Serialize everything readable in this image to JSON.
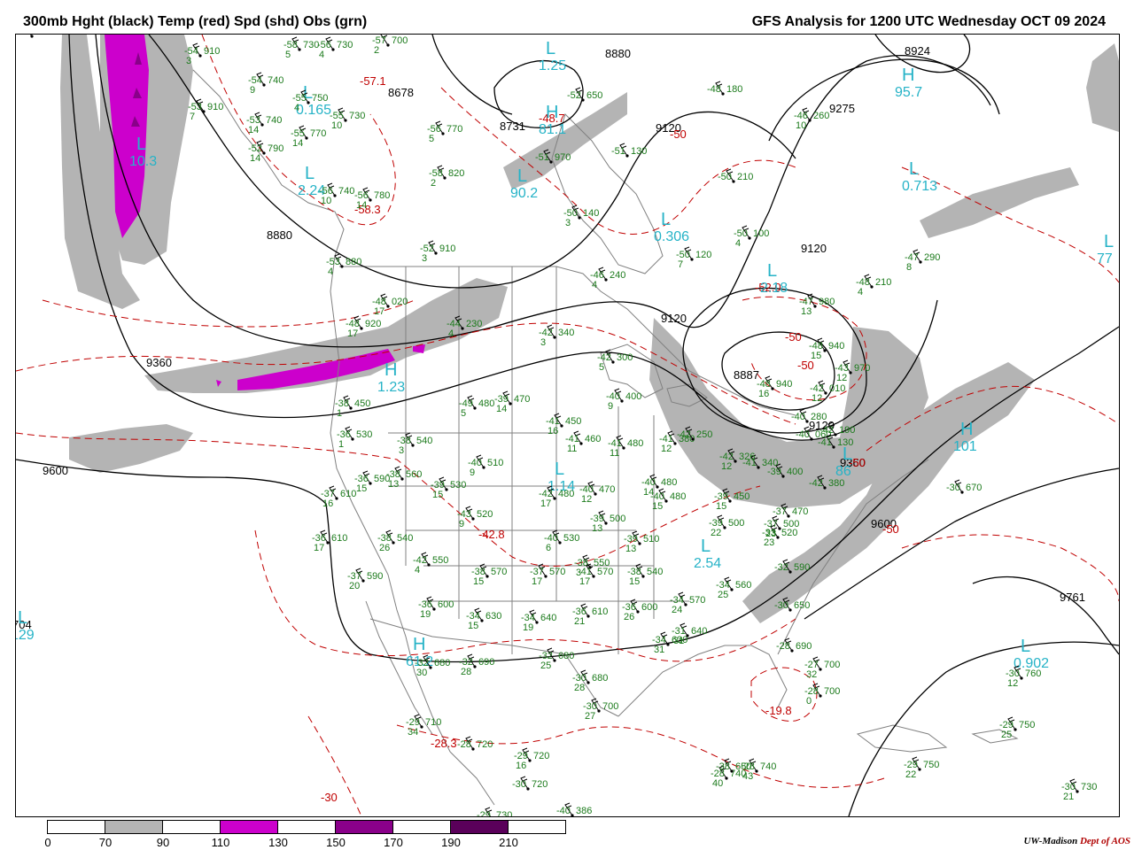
{
  "header": {
    "left_title": "300mb Hght (black) Temp (red) Spd (shd) Obs (grn)",
    "right_title": "GFS Analysis for 1200 UTC Wednesday  OCT 09 2024"
  },
  "legend": {
    "ticks": [
      "0",
      "70",
      "90",
      "110",
      "130",
      "150",
      "170",
      "190",
      "210"
    ],
    "colors": [
      "#ffffff",
      "#b4b4b4",
      "#ffffff",
      "#cc00cc",
      "#ffffff",
      "#8a008a",
      "#ffffff",
      "#5a005a",
      "#ffffff"
    ]
  },
  "credit": {
    "org": "UW-Madison",
    "dept": "Dept of AOS"
  },
  "colors": {
    "height": "#000000",
    "temp": "#c00000",
    "obs": "#1b7a1b",
    "shade_70": "#b4b4b4",
    "shade_110": "#cc00cc",
    "hl": "#26b3c7",
    "borders": "#808080"
  },
  "height_labels": [
    "8880",
    "8678",
    "8731",
    "8880",
    "9120",
    "9275",
    "8924",
    "9120",
    "9120",
    "9360",
    "8887",
    "9120",
    "9360",
    "9600",
    "9600",
    "9761",
    "704"
  ],
  "temp_labels": [
    "-57.1",
    "-48.7",
    "-50",
    "-58.3",
    "-52.0",
    "-50",
    "-50",
    "-42.8",
    "-50",
    "-50",
    "-19.8",
    "-28.3",
    "-30"
  ],
  "hl_markers": [
    {
      "letter": "L",
      "value": "1.25"
    },
    {
      "letter": "L",
      "value": "0.165"
    },
    {
      "letter": "L",
      "value": "2.24"
    },
    {
      "letter": "L",
      "value": "10.3"
    },
    {
      "letter": "H",
      "value": "81.1"
    },
    {
      "letter": "L",
      "value": "90.2"
    },
    {
      "letter": "L",
      "value": "0.306"
    },
    {
      "letter": "H",
      "value": "95.7"
    },
    {
      "letter": "L",
      "value": "0.713"
    },
    {
      "letter": "L",
      "value": "2.18"
    },
    {
      "letter": "H",
      "value": "1.23"
    },
    {
      "letter": "L",
      "value": "1.14"
    },
    {
      "letter": "L",
      "value": "2.54"
    },
    {
      "letter": "H",
      "value": "101"
    },
    {
      "letter": "L",
      "value": "86"
    },
    {
      "letter": "L",
      "value": "129"
    },
    {
      "letter": "H",
      "value": "61.2"
    },
    {
      "letter": "L",
      "value": "0.902"
    },
    {
      "letter": "L",
      "value": "77"
    }
  ],
  "observations": [
    {
      "t": "-54",
      "h": "910",
      "d": "3"
    },
    {
      "t": "-58",
      "h": "730",
      "d": "5"
    },
    {
      "t": "-56",
      "h": "730",
      "d": "4"
    },
    {
      "t": "-57",
      "h": "700",
      "d": "2"
    },
    {
      "t": "-54",
      "h": "740",
      "d": "9"
    },
    {
      "t": "-53",
      "h": "910",
      "d": "7"
    },
    {
      "t": "-55",
      "h": "750",
      "d": "4"
    },
    {
      "t": "-55",
      "h": "730",
      "d": "10"
    },
    {
      "t": "-53",
      "h": "740",
      "d": "14"
    },
    {
      "t": "-55",
      "h": "770",
      "d": "14"
    },
    {
      "t": "-52",
      "h": "790",
      "d": "14"
    },
    {
      "t": "-56",
      "h": "770",
      "d": "5"
    },
    {
      "t": "-52",
      "h": "650",
      "d": ""
    },
    {
      "t": "-51",
      "h": "970",
      "d": ""
    },
    {
      "t": "-51",
      "h": "130",
      "d": ""
    },
    {
      "t": "-48",
      "h": "180",
      "d": ""
    },
    {
      "t": "-46",
      "h": "260",
      "d": "10"
    },
    {
      "t": "-58",
      "h": "820",
      "d": "2"
    },
    {
      "t": "-56",
      "h": "740",
      "d": "10"
    },
    {
      "t": "-56",
      "h": "780",
      "d": "14"
    },
    {
      "t": "-50",
      "h": "140",
      "d": "3"
    },
    {
      "t": "-50",
      "h": "210",
      "d": ""
    },
    {
      "t": "-50",
      "h": "100",
      "d": "4"
    },
    {
      "t": "-50",
      "h": "120",
      "d": "7"
    },
    {
      "t": "-53",
      "h": "880",
      "d": "4"
    },
    {
      "t": "-52",
      "h": "910",
      "d": "3"
    },
    {
      "t": "-47",
      "h": "290",
      "d": "8"
    },
    {
      "t": "-48",
      "h": "210",
      "d": "4"
    },
    {
      "t": "-46",
      "h": "240",
      "d": "4"
    },
    {
      "t": "-48",
      "h": "020",
      "d": "17"
    },
    {
      "t": "-47",
      "h": "980",
      "d": "13"
    },
    {
      "t": "-48",
      "h": "920",
      "d": "17"
    },
    {
      "t": "-44",
      "h": "230",
      "d": "4"
    },
    {
      "t": "-42",
      "h": "340",
      "d": "3"
    },
    {
      "t": "-42",
      "h": "300",
      "d": "5"
    },
    {
      "t": "-48",
      "h": "940",
      "d": "15"
    },
    {
      "t": "-43",
      "h": "970",
      "d": "12"
    },
    {
      "t": "-42",
      "h": "010",
      "d": "12"
    },
    {
      "t": "-48",
      "h": "940",
      "d": "16"
    },
    {
      "t": "-40",
      "h": "400",
      "d": "9"
    },
    {
      "t": "-38",
      "h": "450",
      "d": "1"
    },
    {
      "t": "-49",
      "h": "480",
      "d": "5"
    },
    {
      "t": "-39",
      "h": "470",
      "d": "14"
    },
    {
      "t": "-41",
      "h": "450",
      "d": "16"
    },
    {
      "t": "-41",
      "h": "460",
      "d": "11"
    },
    {
      "t": "-41",
      "h": "480",
      "d": "11"
    },
    {
      "t": "-41",
      "h": "380",
      "d": "12"
    },
    {
      "t": "-36",
      "h": "530",
      "d": "1"
    },
    {
      "t": "-38",
      "h": "540",
      "d": "3"
    },
    {
      "t": "-40",
      "h": "510",
      "d": "9"
    },
    {
      "t": "-36",
      "h": "590",
      "d": "15"
    },
    {
      "t": "-38",
      "h": "560",
      "d": "13"
    },
    {
      "t": "-39",
      "h": "530",
      "d": "15"
    },
    {
      "t": "-42",
      "h": "480",
      "d": "17"
    },
    {
      "t": "-40",
      "h": "470",
      "d": "12"
    },
    {
      "t": "-40",
      "h": "480",
      "d": "14"
    },
    {
      "t": "-40",
      "h": "480",
      "d": "15"
    },
    {
      "t": "-37",
      "h": "610",
      "d": "16"
    },
    {
      "t": "-36",
      "h": "610",
      "d": "17"
    },
    {
      "t": "-38",
      "h": "540",
      "d": "26"
    },
    {
      "t": "-43",
      "h": "520",
      "d": "9"
    },
    {
      "t": "-40",
      "h": "530",
      "d": "6"
    },
    {
      "t": "-39",
      "h": "500",
      "d": "13"
    },
    {
      "t": "-39",
      "h": "510",
      "d": "13"
    },
    {
      "t": "-42",
      "h": "550",
      "d": "4"
    },
    {
      "t": "-38",
      "h": "550",
      "d": "3"
    },
    {
      "t": "-37",
      "h": "590",
      "d": "20"
    },
    {
      "t": "-38",
      "h": "570",
      "d": "15"
    },
    {
      "t": "-37",
      "h": "570",
      "d": "17"
    },
    {
      "t": "-41",
      "h": "570",
      "d": "17"
    },
    {
      "t": "-38",
      "h": "540",
      "d": "15"
    },
    {
      "t": "-34",
      "h": "570",
      "d": "24"
    },
    {
      "t": "-34",
      "h": "560",
      "d": "25"
    },
    {
      "t": "-36",
      "h": "600",
      "d": "19"
    },
    {
      "t": "-34",
      "h": "630",
      "d": "15"
    },
    {
      "t": "-34",
      "h": "640",
      "d": "19"
    },
    {
      "t": "-36",
      "h": "610",
      "d": "21"
    },
    {
      "t": "-36",
      "h": "600",
      "d": "26"
    },
    {
      "t": "-34",
      "h": "630",
      "d": "31"
    },
    {
      "t": "-31",
      "h": "640",
      "d": "31"
    },
    {
      "t": "-30",
      "h": "650",
      "d": ""
    },
    {
      "t": "-32",
      "h": "590",
      "d": ""
    },
    {
      "t": "-32",
      "h": "680",
      "d": "30"
    },
    {
      "t": "-32",
      "h": "690",
      "d": "28"
    },
    {
      "t": "-32",
      "h": "680",
      "d": "25"
    },
    {
      "t": "-28",
      "h": "690",
      "d": ""
    },
    {
      "t": "-27",
      "h": "700",
      "d": "32"
    },
    {
      "t": "-28",
      "h": "700",
      "d": "0"
    },
    {
      "t": "-30",
      "h": "680",
      "d": "28"
    },
    {
      "t": "-30",
      "h": "700",
      "d": "27"
    },
    {
      "t": "-29",
      "h": "710",
      "d": "34"
    },
    {
      "t": "-28",
      "h": "720",
      "d": ""
    },
    {
      "t": "-29",
      "h": "720",
      "d": "16"
    },
    {
      "t": "-30",
      "h": "720",
      "d": ""
    },
    {
      "t": "-29",
      "h": "730",
      "d": ""
    },
    {
      "t": "-28",
      "h": "740",
      "d": "40"
    },
    {
      "t": "-28",
      "h": "740",
      "d": "43"
    },
    {
      "t": "-29",
      "h": "750",
      "d": "22"
    },
    {
      "t": "-29",
      "h": "750",
      "d": "25"
    },
    {
      "t": "-30",
      "h": "760",
      "d": "12"
    },
    {
      "t": "-30",
      "h": "730",
      "d": "21"
    },
    {
      "t": "-30",
      "h": "670",
      "d": ""
    },
    {
      "t": "-33",
      "h": "520",
      "d": "23"
    },
    {
      "t": "-37",
      "h": "500",
      "d": "23"
    },
    {
      "t": "-37",
      "h": "470",
      "d": ""
    },
    {
      "t": "-39",
      "h": "450",
      "d": "15"
    },
    {
      "t": "-39",
      "h": "500",
      "d": "22"
    },
    {
      "t": "-39",
      "h": "400",
      "d": ""
    },
    {
      "t": "-41",
      "h": "340",
      "d": ""
    },
    {
      "t": "-40",
      "h": "280",
      "d": ""
    },
    {
      "t": "-42",
      "h": "250",
      "d": ""
    },
    {
      "t": "-42",
      "h": "326",
      "d": "12"
    },
    {
      "t": "-40",
      "h": "060",
      "d": ""
    },
    {
      "t": "-41",
      "h": "130",
      "d": ""
    },
    {
      "t": "-42",
      "h": "190",
      "d": ""
    },
    {
      "t": "-42",
      "h": "380",
      "d": ""
    },
    {
      "t": "-40",
      "h": "386",
      "d": ""
    },
    {
      "t": "-38",
      "h": "650",
      "d": ""
    },
    {
      "t": "-28",
      "h": "740",
      "d": ""
    }
  ]
}
